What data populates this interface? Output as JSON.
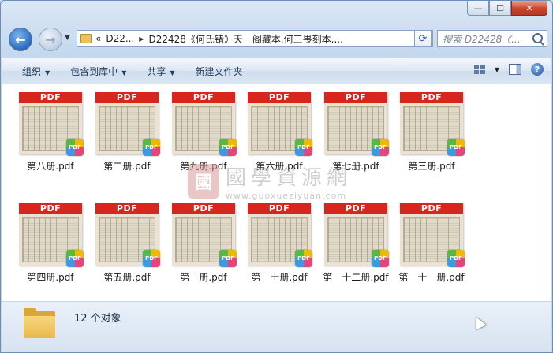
{
  "window": {
    "caption_buttons": {
      "minimize": "—",
      "maximize": "☐",
      "close": "✕"
    }
  },
  "nav": {
    "back_glyph": "←",
    "forward_glyph": "→",
    "breadcrumb_prefix": "«",
    "breadcrumb": [
      "D22...",
      "D22428《何氏锗》天一阁藏本.何三畏刻本...."
    ],
    "refresh_glyph": "⟳",
    "search_placeholder": "搜索 D22428《..."
  },
  "toolbar": {
    "items": [
      {
        "label": "组织",
        "has_dropdown": true
      },
      {
        "label": "包含到库中",
        "has_dropdown": true
      },
      {
        "label": "共享",
        "has_dropdown": true
      },
      {
        "label": "新建文件夹",
        "has_dropdown": false
      }
    ],
    "help_glyph": "?"
  },
  "files": [
    {
      "name": "第八册.pdf",
      "badge": "PDF",
      "icon_label": "PDF"
    },
    {
      "name": "第二册.pdf",
      "badge": "PDF",
      "icon_label": "PDF"
    },
    {
      "name": "第九册.pdf",
      "badge": "PDF",
      "icon_label": "PDF"
    },
    {
      "name": "第六册.pdf",
      "badge": "PDF",
      "icon_label": "PDF"
    },
    {
      "name": "第七册.pdf",
      "badge": "PDF",
      "icon_label": "PDF"
    },
    {
      "name": "第三册.pdf",
      "badge": "PDF",
      "icon_label": "PDF"
    },
    {
      "name": "第四册.pdf",
      "badge": "PDF",
      "icon_label": "PDF"
    },
    {
      "name": "第五册.pdf",
      "badge": "PDF",
      "icon_label": "PDF"
    },
    {
      "name": "第一册.pdf",
      "badge": "PDF",
      "icon_label": "PDF"
    },
    {
      "name": "第一十册.pdf",
      "badge": "PDF",
      "icon_label": "PDF"
    },
    {
      "name": "第一十二册.pdf",
      "badge": "PDF",
      "icon_label": "PDF"
    },
    {
      "name": "第一十一册.pdf",
      "badge": "PDF",
      "icon_label": "PDF"
    }
  ],
  "watermark": {
    "seal": "國",
    "title": "國學資源網",
    "url": "www.guoxueziyuan.com"
  },
  "status": {
    "count_text": "12 个对象"
  },
  "colors": {
    "pdf_band": "#d7261e",
    "window_frame": "#c4d8ee"
  }
}
